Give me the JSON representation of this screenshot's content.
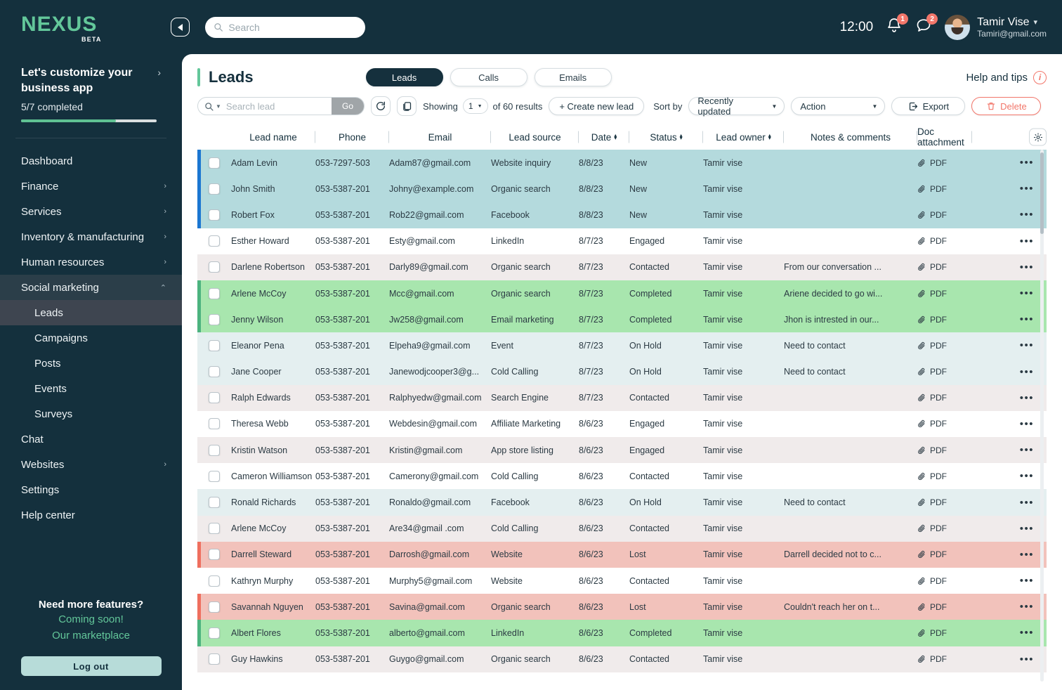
{
  "brand": {
    "name": "NEXUS",
    "tag": "BETA"
  },
  "sidebar": {
    "customize": {
      "title": "Let's customize your business app",
      "subtitle": "5/7 completed",
      "progress_percent": 70
    },
    "items": [
      {
        "label": "Dashboard",
        "caret": "",
        "level": "top"
      },
      {
        "label": "Finance",
        "caret": "›",
        "level": "top"
      },
      {
        "label": "Services",
        "caret": "›",
        "level": "top"
      },
      {
        "label": "Inventory & manufacturing",
        "caret": "›",
        "level": "top"
      },
      {
        "label": "Human resources",
        "caret": "›",
        "level": "top"
      },
      {
        "label": "Social marketing",
        "caret": "^",
        "level": "top",
        "state": "expanded"
      },
      {
        "label": "Leads",
        "caret": "",
        "level": "sub",
        "state": "active"
      },
      {
        "label": "Campaigns",
        "caret": "",
        "level": "sub"
      },
      {
        "label": "Posts",
        "caret": "",
        "level": "sub"
      },
      {
        "label": "Events",
        "caret": "",
        "level": "sub"
      },
      {
        "label": "Surveys",
        "caret": "",
        "level": "sub"
      },
      {
        "label": "Chat",
        "caret": "",
        "level": "top"
      },
      {
        "label": "Websites",
        "caret": "›",
        "level": "top"
      },
      {
        "label": "Settings",
        "caret": "",
        "level": "top"
      },
      {
        "label": "Help center",
        "caret": "",
        "level": "top"
      }
    ],
    "promo": {
      "question": "Need more features?",
      "line1": "Coming soon!",
      "line2": "Our marketplace",
      "logout_label": "Log out"
    }
  },
  "topbar": {
    "search_placeholder": "Search",
    "search_value": "",
    "clock": "12:00",
    "notification_count": "1",
    "message_count": "2",
    "user_name": "Tamir Vise",
    "user_email": "Tamiri@gmail.com"
  },
  "page": {
    "title": "Leads",
    "tabs": [
      {
        "label": "Leads",
        "active": true
      },
      {
        "label": "Calls",
        "active": false
      },
      {
        "label": "Emails",
        "active": false
      }
    ],
    "help_label": "Help and tips"
  },
  "toolbar": {
    "search_placeholder": "Search lead",
    "search_value": "",
    "go_label": "Go",
    "showing_label": "Showing",
    "page_value": "1",
    "results_label": "of 60 results",
    "create_label": "+ Create new lead",
    "sortby_label": "Sort by",
    "sort_value": "Recently updated",
    "action_value": "Action",
    "export_label": "Export",
    "delete_label": "Delete"
  },
  "table": {
    "columns": [
      {
        "label": "Lead name",
        "sortable": false
      },
      {
        "label": "Phone",
        "sortable": false
      },
      {
        "label": "Email",
        "sortable": false
      },
      {
        "label": "Lead source",
        "sortable": false
      },
      {
        "label": "Date",
        "sortable": true
      },
      {
        "label": "Status",
        "sortable": true
      },
      {
        "label": "Lead owner",
        "sortable": true
      },
      {
        "label": "Notes & comments",
        "sortable": false
      },
      {
        "label": "Doc attachment",
        "sortable": false
      }
    ],
    "doc_label": "PDF",
    "rows": [
      {
        "name": "Adam Levin",
        "phone": "053-7297-503",
        "email": "Adam87@gmail.com",
        "source": "Website inquiry",
        "date": "8/8/23",
        "status": "New",
        "owner": "Tamir vise",
        "notes": "",
        "doc": "PDF",
        "tone": "new",
        "accent": "#1b76d1"
      },
      {
        "name": "John Smith",
        "phone": "053-5387-201",
        "email": "Johny@example.com",
        "source": "Organic search",
        "date": "8/8/23",
        "status": "New",
        "owner": "Tamir vise",
        "notes": "",
        "doc": "PDF",
        "tone": "new",
        "accent": "#1b76d1"
      },
      {
        "name": "Robert Fox",
        "phone": "053-5387-201",
        "email": "Rob22@gmail.com",
        "source": "Facebook",
        "date": "8/8/23",
        "status": "New",
        "owner": "Tamir vise",
        "notes": "",
        "doc": "PDF",
        "tone": "new",
        "accent": "#1b76d1"
      },
      {
        "name": "Esther Howard",
        "phone": "053-5387-201",
        "email": "Esty@gmail.com",
        "source": "LinkedIn",
        "date": "8/7/23",
        "status": "Engaged",
        "owner": "Tamir vise",
        "notes": "",
        "doc": "PDF",
        "tone": "white",
        "accent": ""
      },
      {
        "name": "Darlene Robertson",
        "phone": "053-5387-201",
        "email": "Darly89@gmail.com",
        "source": "Organic search",
        "date": "8/7/23",
        "status": "Contacted",
        "owner": "Tamir vise",
        "notes": "From our conversation ...",
        "doc": "PDF",
        "tone": "grey",
        "accent": ""
      },
      {
        "name": "Arlene McCoy",
        "phone": "053-5387-201",
        "email": "Mcc@gmail.com",
        "source": "Organic search",
        "date": "8/7/23",
        "status": "Completed",
        "owner": "Tamir vise",
        "notes": "Ariene decided to go wi...",
        "doc": "PDF",
        "tone": "completed",
        "accent": "#4cb37f"
      },
      {
        "name": "Jenny Wilson",
        "phone": "053-5387-201",
        "email": "Jw258@gmail.com",
        "source": "Email marketing",
        "date": "8/7/23",
        "status": "Completed",
        "owner": "Tamir vise",
        "notes": "Jhon  is intrested in our...",
        "doc": "PDF",
        "tone": "completed",
        "accent": "#4cb37f"
      },
      {
        "name": "Eleanor Pena",
        "phone": "053-5387-201",
        "email": "Elpeha9@gmail.com",
        "source": "Event",
        "date": "8/7/23",
        "status": "On Hold",
        "owner": "Tamir vise",
        "notes": "Need to contact",
        "doc": "PDF",
        "tone": "hold",
        "accent": ""
      },
      {
        "name": "Jane Cooper",
        "phone": "053-5387-201",
        "email": "Janewodjcooper3@g...",
        "source": "Cold Calling",
        "date": "8/7/23",
        "status": "On Hold",
        "owner": "Tamir vise",
        "notes": "Need to contact",
        "doc": "PDF",
        "tone": "hold",
        "accent": ""
      },
      {
        "name": "Ralph Edwards",
        "phone": "053-5387-201",
        "email": "Ralphyedw@gmail.com",
        "source": "Search Engine",
        "date": "8/7/23",
        "status": "Contacted",
        "owner": "Tamir vise",
        "notes": "",
        "doc": "PDF",
        "tone": "grey",
        "accent": ""
      },
      {
        "name": "Theresa Webb",
        "phone": "053-5387-201",
        "email": "Webdesin@gmail.com",
        "source": "Affiliate Marketing",
        "date": "8/6/23",
        "status": "Engaged",
        "owner": "Tamir vise",
        "notes": "",
        "doc": "PDF",
        "tone": "white",
        "accent": ""
      },
      {
        "name": "Kristin Watson",
        "phone": "053-5387-201",
        "email": "Kristin@gmail.com",
        "source": "App store listing",
        "date": "8/6/23",
        "status": "Engaged",
        "owner": "Tamir vise",
        "notes": "",
        "doc": "PDF",
        "tone": "grey",
        "accent": ""
      },
      {
        "name": "Cameron Williamson",
        "phone": "053-5387-201",
        "email": "Camerony@gmail.com",
        "source": "Cold Calling",
        "date": "8/6/23",
        "status": "Contacted",
        "owner": "Tamir vise",
        "notes": "",
        "doc": "PDF",
        "tone": "white",
        "accent": ""
      },
      {
        "name": "Ronald Richards",
        "phone": "053-5387-201",
        "email": "Ronaldo@gmail.com",
        "source": "Facebook",
        "date": "8/6/23",
        "status": "On Hold",
        "owner": "Tamir vise",
        "notes": "Need to contact",
        "doc": "PDF",
        "tone": "hold",
        "accent": ""
      },
      {
        "name": "Arlene McCoy",
        "phone": "053-5387-201",
        "email": "Are34@gmail .com",
        "source": "Cold Calling",
        "date": "8/6/23",
        "status": "Contacted",
        "owner": "Tamir vise",
        "notes": "",
        "doc": "PDF",
        "tone": "grey",
        "accent": ""
      },
      {
        "name": "Darrell Steward",
        "phone": "053-5387-201",
        "email": "Darrosh@gmail.com",
        "source": "Website",
        "date": "8/6/23",
        "status": "Lost",
        "owner": "Tamir vise",
        "notes": "Darrell decided not to c...",
        "doc": "PDF",
        "tone": "lost",
        "accent": "#ef6f5e"
      },
      {
        "name": "Kathryn Murphy",
        "phone": "053-5387-201",
        "email": "Murphy5@gmail.com",
        "source": "Website",
        "date": "8/6/23",
        "status": "Contacted",
        "owner": "Tamir vise",
        "notes": "",
        "doc": "PDF",
        "tone": "white",
        "accent": ""
      },
      {
        "name": "Savannah Nguyen",
        "phone": "053-5387-201",
        "email": "Savina@gmail.com",
        "source": "Organic search",
        "date": "8/6/23",
        "status": "Lost",
        "owner": "Tamir vise",
        "notes": "Couldn't reach her on t...",
        "doc": "PDF",
        "tone": "lost",
        "accent": "#ef6f5e"
      },
      {
        "name": "Albert Flores",
        "phone": "053-5387-201",
        "email": "alberto@gmail.com",
        "source": "LinkedIn",
        "date": "8/6/23",
        "status": "Completed",
        "owner": "Tamir vise",
        "notes": "",
        "doc": "PDF",
        "tone": "completed",
        "accent": "#4cb37f"
      },
      {
        "name": "Guy Hawkins",
        "phone": "053-5387-201",
        "email": "Guygo@gmail.com",
        "source": "Organic search",
        "date": "8/6/23",
        "status": "Contacted",
        "owner": "Tamir vise",
        "notes": "",
        "doc": "PDF",
        "tone": "grey",
        "accent": ""
      }
    ]
  },
  "colors": {
    "sidebar_bg": "#14303d",
    "accent_green": "#63c79a",
    "row_new": "#b4dadd",
    "row_completed": "#a8e6ae",
    "row_lost": "#f2c2bb",
    "row_hold": "#e4eff0",
    "row_grey": "#f0ebeb",
    "danger": "#f2766a"
  }
}
